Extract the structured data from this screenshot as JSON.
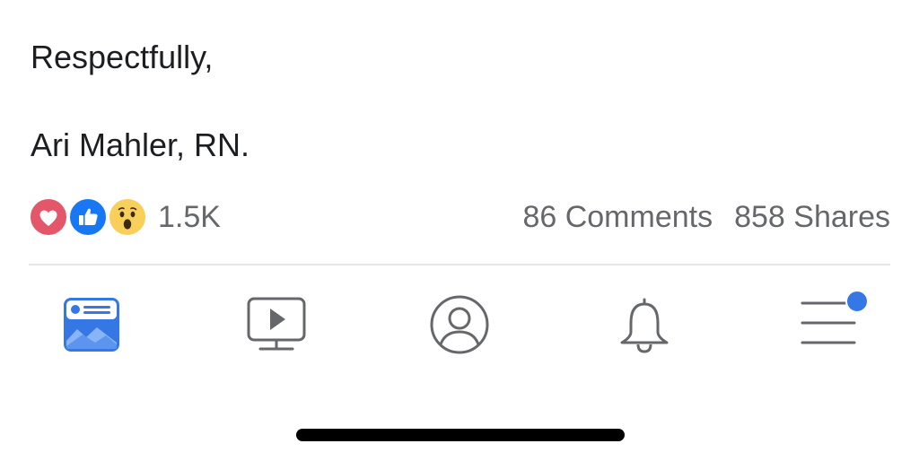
{
  "post": {
    "closing": "Respectfully,",
    "signature": "Ari Mahler, RN."
  },
  "reactions": {
    "icons": [
      "heart-love-icon",
      "thumbs-up-like-icon",
      "wow-face-icon"
    ],
    "count": "1.5K"
  },
  "engagement": {
    "comments": "86 Comments",
    "shares": "858 Shares"
  },
  "tab_bar": {
    "items": [
      {
        "name": "news-feed",
        "icon": "news-feed-icon",
        "active": true
      },
      {
        "name": "watch",
        "icon": "watch-video-icon",
        "active": false
      },
      {
        "name": "profile",
        "icon": "profile-icon",
        "active": false
      },
      {
        "name": "notifications",
        "icon": "bell-icon",
        "active": false
      },
      {
        "name": "menu",
        "icon": "hamburger-menu-icon",
        "active": false,
        "badge": true
      }
    ]
  },
  "colors": {
    "text": "#1c1e21",
    "secondary_text": "#65676b",
    "facebook_blue": "#1877f2",
    "love_red": "#e4566a",
    "wow_yellow": "#f7cf5a",
    "icon_gray": "#65676b"
  }
}
